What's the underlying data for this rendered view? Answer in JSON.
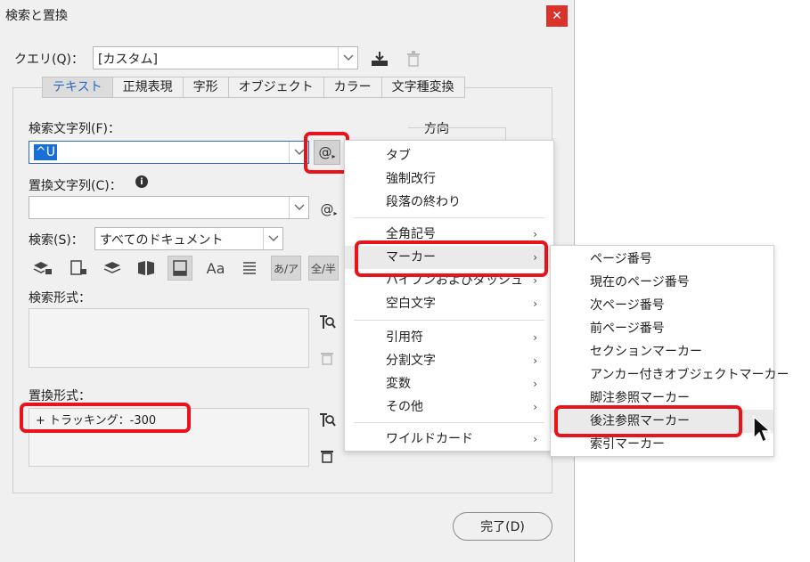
{
  "dialog": {
    "title": "検索と置換",
    "close": "✕"
  },
  "query": {
    "label": "クエリ(Q)：",
    "value": "[カスタム]",
    "arrow": "⌄"
  },
  "tabs": [
    "テキスト",
    "正規表現",
    "字形",
    "オブジェクト",
    "カラー",
    "文字種変換"
  ],
  "find": {
    "label": "検索文字列(F)：",
    "value": "^U",
    "special_btn": "@"
  },
  "direction": {
    "label": "方向"
  },
  "replace": {
    "label": "置換文字列(C)：",
    "info": "i",
    "value": "",
    "special_btn": "@"
  },
  "search": {
    "label": "検索(S)：",
    "value": "すべてのドキュメント"
  },
  "options": {
    "case_label": "Aa",
    "kana_label": "あ/ア",
    "width_label": "全/半"
  },
  "find_format": {
    "label": "検索形式：",
    "value": ""
  },
  "replace_format": {
    "label": "置換形式：",
    "value": "+ トラッキング：-300"
  },
  "done": {
    "label": "完了(D)"
  },
  "special_menu": {
    "items": [
      {
        "label": "タブ",
        "submenu": false
      },
      {
        "label": "強制改行",
        "submenu": false
      },
      {
        "label": "段落の終わり",
        "submenu": false
      },
      {
        "label": "全角記号",
        "submenu": true
      },
      {
        "label": "マーカー",
        "submenu": true
      },
      {
        "label": "ハイフンおよびダッシュ",
        "submenu": true
      },
      {
        "label": "空白文字",
        "submenu": true
      },
      {
        "label": "引用符",
        "submenu": true
      },
      {
        "label": "分割文字",
        "submenu": true
      },
      {
        "label": "変数",
        "submenu": true
      },
      {
        "label": "その他",
        "submenu": true
      },
      {
        "label": "ワイルドカード",
        "submenu": true
      }
    ],
    "chevron": "›"
  },
  "marker_submenu": {
    "items": [
      "ページ番号",
      "現在のページ番号",
      "次ページ番号",
      "前ページ番号",
      "セクションマーカー",
      "アンカー付きオブジェクトマーカー",
      "脚注参照マーカー",
      "後注参照マーカー",
      "索引マーカー"
    ]
  },
  "colors": {
    "accent": "#2a6ac4",
    "selection": "#1a6fd6",
    "highlight_box": "#e8131b",
    "close_button": "#d9342b"
  }
}
